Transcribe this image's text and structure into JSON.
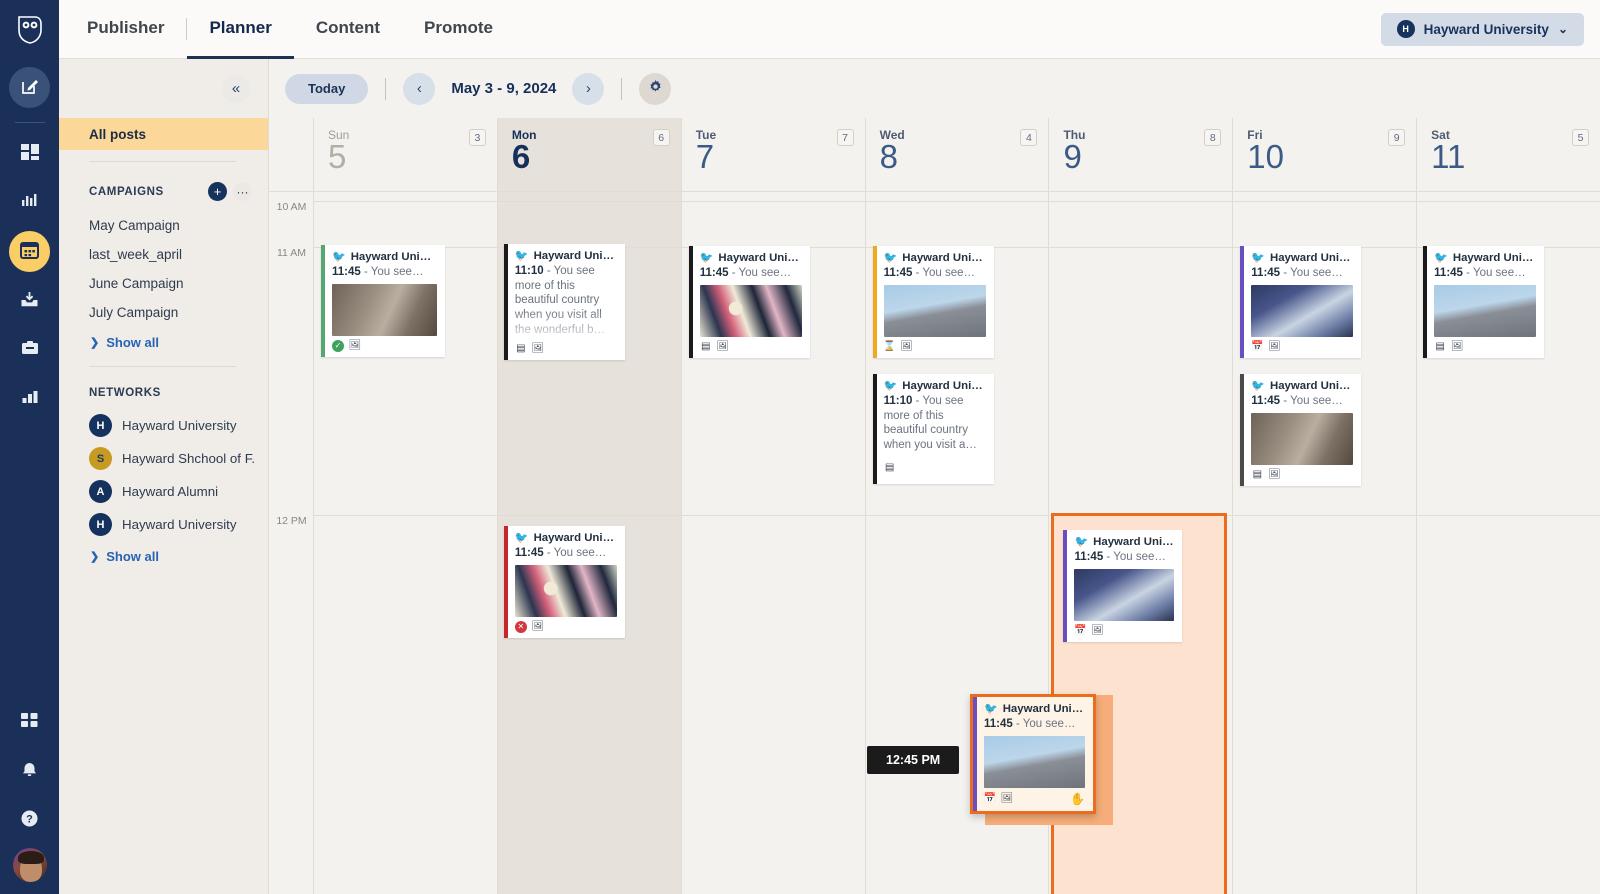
{
  "rail": {
    "logo_icon": "hootsuite-owl-logo",
    "items": [
      {
        "name": "compose",
        "icon": "compose-icon",
        "active": false
      },
      {
        "name": "streams",
        "icon": "grid-streams-icon",
        "active": false
      },
      {
        "name": "insights",
        "icon": "bars-insights-icon",
        "active": false
      },
      {
        "name": "planner",
        "icon": "calendar-icon",
        "active": true
      },
      {
        "name": "inbox",
        "icon": "inbox-download-icon",
        "active": false
      },
      {
        "name": "content",
        "icon": "clipboard-icon",
        "active": false
      },
      {
        "name": "analytics",
        "icon": "bar-chart-icon",
        "active": false
      }
    ],
    "bottom": [
      {
        "name": "apps",
        "icon": "apps-grid-icon"
      },
      {
        "name": "notifications",
        "icon": "bell-icon"
      },
      {
        "name": "help",
        "icon": "question-mark-icon"
      }
    ],
    "avatar_name": "user-avatar"
  },
  "header": {
    "tabs": [
      {
        "label": "Publisher",
        "active": false
      },
      {
        "label": "Planner",
        "active": true
      },
      {
        "label": "Content",
        "active": false
      },
      {
        "label": "Promote",
        "active": false
      }
    ],
    "account": {
      "label": "Hayward University",
      "initial": "H",
      "chevron": "⌄"
    }
  },
  "sidebar": {
    "collapse_icon": "«",
    "all_posts": "All posts",
    "campaigns": {
      "title": "CAMPAIGNS",
      "add_icon": "+",
      "more_icon": "···",
      "items": [
        "May Campaign",
        "last_week_april",
        "June Campaign",
        "July Campaign"
      ],
      "show_all": "Show all"
    },
    "networks": {
      "title": "NETWORKS",
      "items": [
        {
          "label": "Hayward University",
          "badge": "fb",
          "initial": "H",
          "style": "navy"
        },
        {
          "label": "Hayward Shchool of F...",
          "badge": "fb",
          "initial": "S",
          "style": "gold"
        },
        {
          "label": "Hayward Alumni",
          "badge": "fb",
          "initial": "A",
          "style": "navy"
        },
        {
          "label": "Hayward University",
          "badge": "tw",
          "initial": "H",
          "style": "navy"
        }
      ],
      "show_all": "Show all"
    }
  },
  "toolbar": {
    "today_label": "Today",
    "prev_icon": "‹",
    "next_icon": "›",
    "date_range": "May 3 - 9, 2024",
    "settings_icon": "gear-icon"
  },
  "calendar": {
    "days": [
      {
        "name": "Sun",
        "num": "5",
        "count": "3",
        "state": "muted"
      },
      {
        "name": "Mon",
        "num": "6",
        "count": "6",
        "state": "today"
      },
      {
        "name": "Tue",
        "num": "7",
        "count": "7",
        "state": "normal"
      },
      {
        "name": "Wed",
        "num": "8",
        "count": "4",
        "state": "normal"
      },
      {
        "name": "Thu",
        "num": "9",
        "count": "8",
        "state": "normal"
      },
      {
        "name": "Fri",
        "num": "10",
        "count": "9",
        "state": "normal"
      },
      {
        "name": "Sat",
        "num": "11",
        "count": "5",
        "state": "normal"
      }
    ],
    "hours": [
      "10 AM",
      "11 AM",
      "12 PM"
    ],
    "drag_time_chip": "12:45 PM",
    "posts": [
      {
        "day": 0,
        "slot": "11am",
        "time": "11:45",
        "text": "You see…",
        "name": "Hayward Unive…",
        "bar": "#57a773",
        "thumb": "th-bldg1",
        "icons": [
          "ok",
          "img"
        ],
        "truncate": true
      },
      {
        "day": 1,
        "slot": "11am",
        "time": "11:10",
        "text": "You see more of this beautiful country when you visit all the wonderful b…",
        "name": "Hayward Unive…",
        "bar": "#1b1b1b",
        "thumb": null,
        "icons": [
          "draft",
          "img"
        ],
        "truncate": false
      },
      {
        "day": 2,
        "slot": "11am",
        "time": "11:45",
        "text": "You see…",
        "name": "Hayward Unive…",
        "bar": "#1b1b1b",
        "thumb": "th-art",
        "icons": [
          "draft",
          "img"
        ],
        "truncate": true
      },
      {
        "day": 3,
        "slot": "11am",
        "time": "11:45",
        "text": "You see…",
        "name": "Hayward Unive…",
        "bar": "#f0a81e",
        "thumb": "th-sky",
        "icons": [
          "pend",
          "img"
        ],
        "truncate": true
      },
      {
        "day": 3,
        "slot": "11am2",
        "time": "11:10",
        "text": "You see more of this beautiful country when you visit a…",
        "name": "Hayward Unive…",
        "bar": "#1b1b1b",
        "thumb": null,
        "icons": [
          "draft"
        ],
        "truncate": false
      },
      {
        "day": 5,
        "slot": "11am",
        "time": "11:45",
        "text": "You see…",
        "name": "Hayward Unive…",
        "bar": "#6a4fc0",
        "thumb": "th-night",
        "icons": [
          "cal",
          "img"
        ],
        "truncate": true
      },
      {
        "day": 5,
        "slot": "11am2",
        "time": "11:45",
        "text": "You see…",
        "name": "Hayward Unive…",
        "bar": "#4a4a4a",
        "thumb": "th-bldg1",
        "icons": [
          "draft",
          "img"
        ],
        "truncate": true
      },
      {
        "day": 6,
        "slot": "11am",
        "time": "11:45",
        "text": "You see…",
        "name": "Hayward Unive…",
        "bar": "#1b1b1b",
        "thumb": "th-sky",
        "icons": [
          "draft",
          "img"
        ],
        "truncate": true
      },
      {
        "day": 1,
        "slot": "12pm",
        "time": "11:45",
        "text": "You see…",
        "name": "Hayward Unive…",
        "bar": "#c3272b",
        "thumb": "th-art",
        "icons": [
          "err",
          "img"
        ],
        "truncate": true
      },
      {
        "day": 4,
        "slot": "12pm",
        "time": "11:45",
        "text": "You see…",
        "name": "Hayward Unive…",
        "bar": "#6a4fc0",
        "thumb": "th-night",
        "icons": [
          "cal",
          "img"
        ],
        "truncate": true
      }
    ],
    "dragging_post": {
      "time": "11:45",
      "text": "You see…",
      "name": "Hayward Unive…",
      "bar": "#6a4fc0",
      "thumb": "th-sky",
      "icons": [
        "cal",
        "img"
      ],
      "grab_icon": "grab-hand-icon"
    }
  },
  "colors": {
    "accent": "#fbcd66",
    "navy": "#1a3059",
    "drag_orange": "#ec6c1f",
    "drop_fill": "#fde2cf"
  }
}
